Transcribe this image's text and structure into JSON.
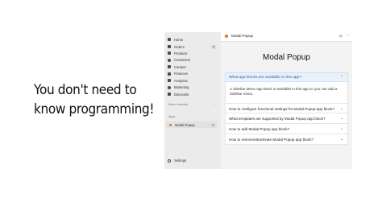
{
  "headline": {
    "line1": "You don't need to",
    "line2": "know programming!"
  },
  "sidebar": {
    "items": [
      {
        "label": "Home",
        "icon": "home-icon"
      },
      {
        "label": "Orders",
        "icon": "orders-icon",
        "badge": "4"
      },
      {
        "label": "Products",
        "icon": "tag-icon"
      },
      {
        "label": "Customers",
        "icon": "person-icon"
      },
      {
        "label": "Content",
        "icon": "content-icon"
      },
      {
        "label": "Finances",
        "icon": "bank-icon"
      },
      {
        "label": "Analytics",
        "icon": "chart-icon"
      },
      {
        "label": "Marketing",
        "icon": "target-icon"
      },
      {
        "label": "Discounts",
        "icon": "discount-icon"
      }
    ],
    "sales_channels_label": "Sales channels",
    "apps_label": "Apps",
    "active_app": {
      "label": "Modal Popup",
      "pin": "⊡"
    },
    "settings_label": "Settings"
  },
  "topbar": {
    "title": "Modal Popup",
    "pin": "⊡",
    "more": "···"
  },
  "page": {
    "title": "Modal Popup"
  },
  "faq": {
    "open_question": "What app blocks are available in this app?",
    "open_answer": "A Sidebar Menu app block is available in this app so you can add a Sidebar menu.",
    "questions": [
      "How to configure functional settings for Modal Popup app block?",
      "What templates are supported by Modal Popup app block?",
      "How to add Modal Popup app block?",
      "How to remove/deactivate Modal Popup app block?"
    ]
  },
  "colors": {
    "accent_blue": "#1f5fa8",
    "open_panel_bg": "#e9f2fb",
    "app_logo": "#e0842d"
  }
}
